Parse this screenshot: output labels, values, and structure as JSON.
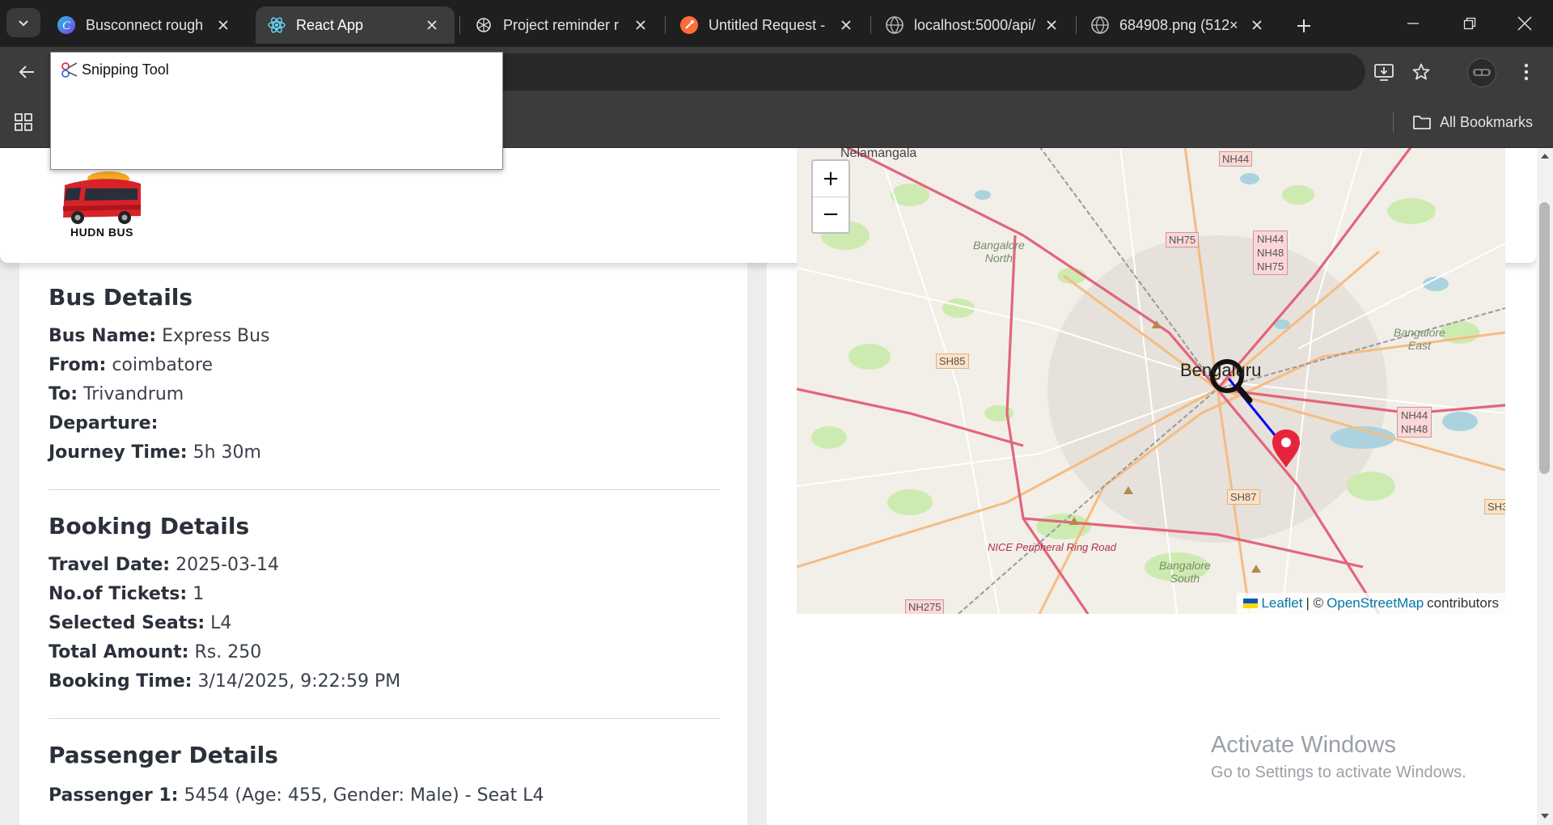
{
  "browser": {
    "tabs": [
      {
        "title": "Busconnect rough",
        "icon": "canva-icon",
        "active": false
      },
      {
        "title": "React App",
        "icon": "react-icon",
        "active": true
      },
      {
        "title": "Project reminder r",
        "icon": "chatgpt-icon",
        "active": false
      },
      {
        "title": "Untitled Request -",
        "icon": "postman-icon",
        "active": false
      },
      {
        "title": "localhost:5000/api/",
        "icon": "globe-icon",
        "active": false
      },
      {
        "title": "684908.png (512×",
        "icon": "globe-icon",
        "active": false
      }
    ],
    "bookmarks_label": "All Bookmarks"
  },
  "snipping_tool": {
    "label": "Snipping Tool"
  },
  "header": {
    "logo_text": "HUDN BUS"
  },
  "bus_details": {
    "title": "Bus Details",
    "rows": [
      {
        "label": "Bus Name:",
        "value": "Express Bus"
      },
      {
        "label": "From:",
        "value": "coimbatore"
      },
      {
        "label": "To:",
        "value": "Trivandrum"
      },
      {
        "label": "Departure:",
        "value": ""
      },
      {
        "label": "Journey Time:",
        "value": "5h 30m"
      }
    ]
  },
  "booking_details": {
    "title": "Booking Details",
    "rows": [
      {
        "label": "Travel Date:",
        "value": "2025-03-14"
      },
      {
        "label": "No.of Tickets:",
        "value": "1"
      },
      {
        "label": "Selected Seats:",
        "value": "L4"
      },
      {
        "label": "Total Amount:",
        "value": "Rs. 250"
      },
      {
        "label": "Booking Time:",
        "value": "3/14/2025, 9:22:59 PM"
      }
    ]
  },
  "passenger_details": {
    "title": "Passenger Details",
    "rows": [
      {
        "label": "Passenger 1:",
        "value": "5454 (Age: 455, Gender: Male) - Seat L4"
      }
    ]
  },
  "map": {
    "zoom_in": "+",
    "zoom_out": "−",
    "labels": {
      "nelamangala": "Nelamangala",
      "nh44_top": "NH44",
      "nh75": "NH75",
      "nh44": "NH44",
      "nh48": "NH48",
      "nh75b": "NH75",
      "bangalore_north_1": "Bangalore",
      "bangalore_north_2": "North",
      "sh85": "SH85",
      "bengaluru": "Bengaluru",
      "bangalore_east_1": "Bangalore",
      "bangalore_east_2": "East",
      "nh44_r": "NH44",
      "nh48_r": "NH48",
      "sh87": "SH87",
      "sh3": "SH3",
      "nice_road": "NICE Peripheral Ring Road",
      "bangalore_south_1": "Bangalore",
      "bangalore_south_2": "South",
      "nh275": "NH275"
    },
    "attribution": {
      "leaflet": "Leaflet",
      "sep": "| ©",
      "osm": "OpenStreetMap",
      "contributors": "contributors"
    },
    "route_color": "#0000ff",
    "marker_color": "#e8243c"
  },
  "watermark": {
    "line1": "Activate Windows",
    "line2": "Go to Settings to activate Windows."
  }
}
